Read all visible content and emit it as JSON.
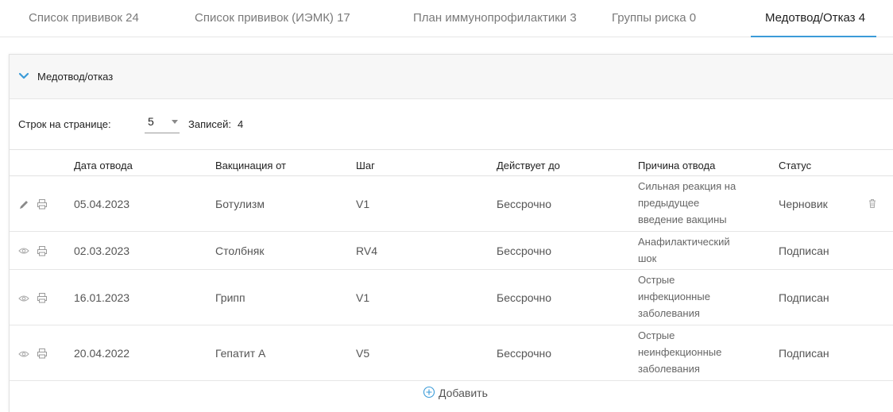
{
  "tabs": [
    {
      "label": "Список прививок 24"
    },
    {
      "label": "Список прививок (ИЭМК) 17"
    },
    {
      "label": "План иммунопрофилактики 3"
    },
    {
      "label": "Группы риска 0"
    },
    {
      "label": "Медотвод/Отказ 4"
    }
  ],
  "panel": {
    "title": "Медотвод/отказ"
  },
  "pagination": {
    "rows_label": "Строк на странице:",
    "rows_value": "5",
    "records_label": "Записей:",
    "records_value": "4"
  },
  "table": {
    "headers": [
      "Дата отвода",
      "Вакцинация от",
      "Шаг",
      "Действует до",
      "Причина отвода",
      "Статус"
    ],
    "rows": [
      {
        "date": "05.04.2023",
        "vaccine": "Ботулизм",
        "step": "V1",
        "until": "Бессрочно",
        "reason": [
          "Сильная реакция на",
          "предыдущее",
          "введение вакцины"
        ],
        "status": "Черновик"
      },
      {
        "date": "02.03.2023",
        "vaccine": "Столбняк",
        "step": "RV4",
        "until": "Бессрочно",
        "reason": [
          "Анафилактический",
          "шок"
        ],
        "status": "Подписан"
      },
      {
        "date": "16.01.2023",
        "vaccine": "Грипп",
        "step": "V1",
        "until": "Бессрочно",
        "reason": [
          "Острые",
          "инфекционные",
          "заболевания"
        ],
        "status": "Подписан"
      },
      {
        "date": "20.04.2022",
        "vaccine": "Гепатит А",
        "step": "V5",
        "until": "Бессрочно",
        "reason": [
          "Острые",
          "неинфекционные",
          "заболевания"
        ],
        "status": "Подписан"
      }
    ]
  },
  "actions": {
    "add_label": "Добавить"
  },
  "colors": {
    "accent": "#3b9bd8",
    "icon": "#9a9a9a"
  }
}
